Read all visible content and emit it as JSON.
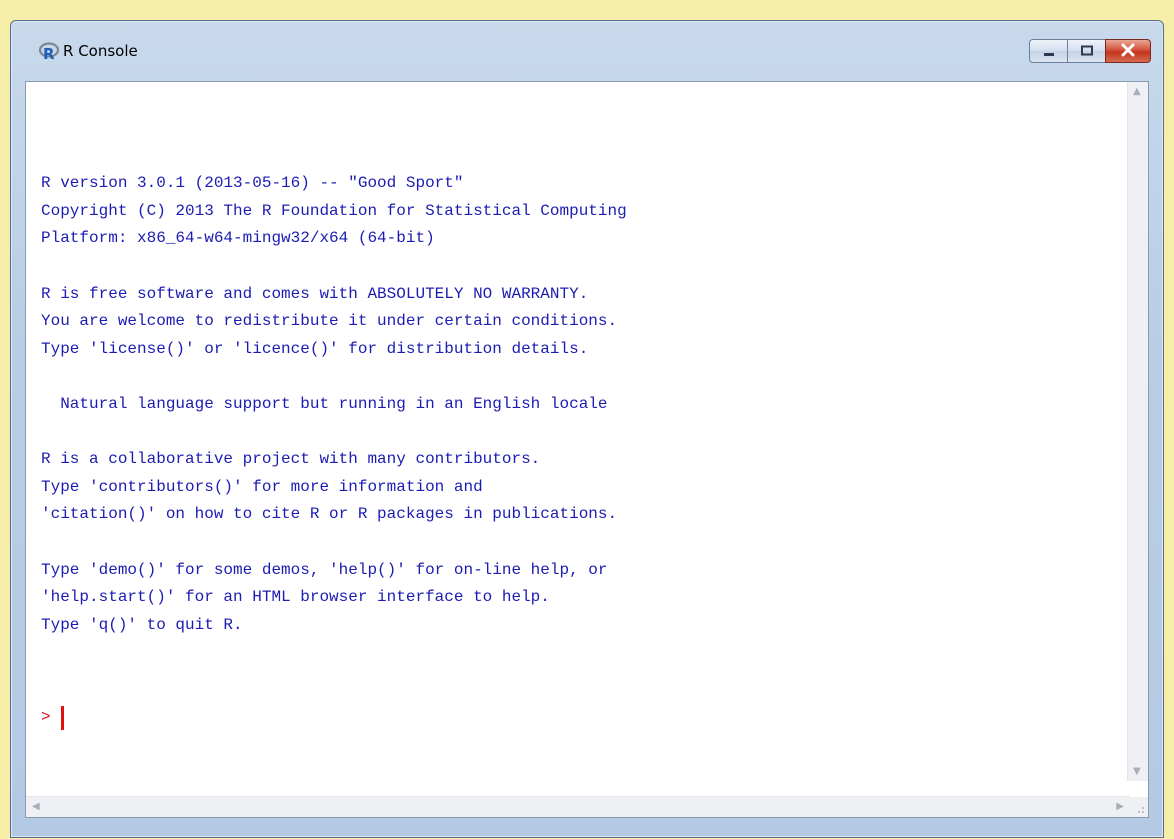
{
  "window": {
    "title": "R Console",
    "icon": "r-logo-icon"
  },
  "controls": {
    "minimize_icon": "minimize-icon",
    "maximize_icon": "maximize-icon",
    "close_icon": "close-icon"
  },
  "console": {
    "lines": [
      "R version 3.0.1 (2013-05-16) -- \"Good Sport\"",
      "Copyright (C) 2013 The R Foundation for Statistical Computing",
      "Platform: x86_64-w64-mingw32/x64 (64-bit)",
      "",
      "R is free software and comes with ABSOLUTELY NO WARRANTY.",
      "You are welcome to redistribute it under certain conditions.",
      "Type 'license()' or 'licence()' for distribution details.",
      "",
      "  Natural language support but running in an English locale",
      "",
      "R is a collaborative project with many contributors.",
      "Type 'contributors()' for more information and",
      "'citation()' on how to cite R or R packages in publications.",
      "",
      "Type 'demo()' for some demos, 'help()' for on-line help, or",
      "'help.start()' for an HTML browser interface to help.",
      "Type 'q()' to quit R."
    ],
    "prompt": ">",
    "input_value": ""
  },
  "colors": {
    "output_text": "#1c1cb4",
    "prompt": "#e01010",
    "desktop_background": "#f6eea8"
  }
}
